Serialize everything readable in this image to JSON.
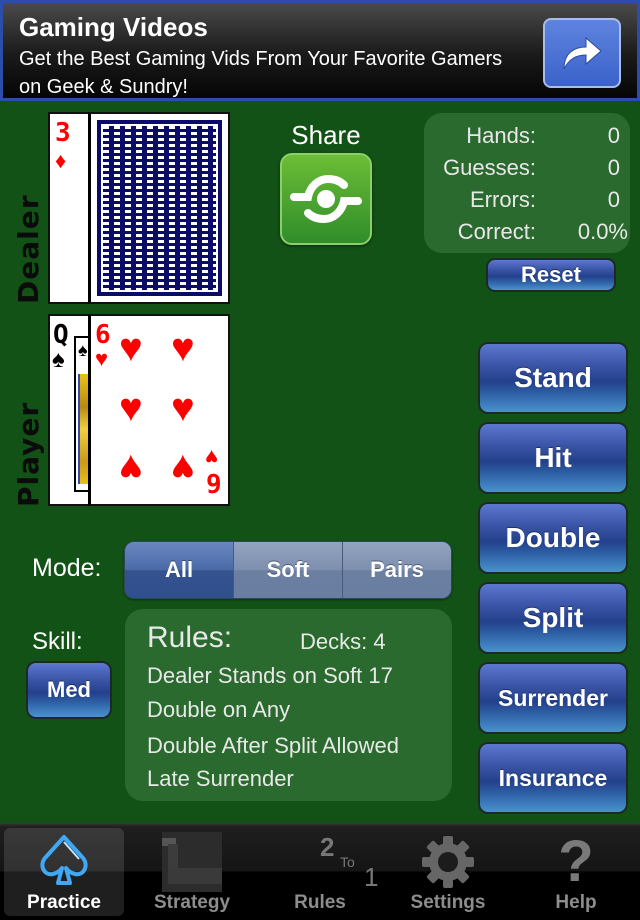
{
  "ad": {
    "title": "Gaming Videos",
    "text": "Get the Best Gaming Vids From Your Favorite Gamers on Geek & Sundry!",
    "action_icon": "share-arrow-icon"
  },
  "table": {
    "dealer_label": "Dealer",
    "player_label": "Player",
    "dealer_cards": [
      {
        "rank": "3",
        "suit": "diamonds",
        "suit_glyph": "♦"
      },
      {
        "rank": "",
        "suit": "",
        "face_down": true
      }
    ],
    "player_cards": [
      {
        "rank": "Q",
        "suit": "spades",
        "suit_glyph": "♠"
      },
      {
        "rank": "6",
        "suit": "hearts",
        "suit_glyph": "♥",
        "rank_rotated": "9"
      }
    ]
  },
  "share": {
    "label": "Share",
    "icon": "share-icon"
  },
  "stats": {
    "rows": [
      {
        "label": "Hands:",
        "value": "0"
      },
      {
        "label": "Guesses:",
        "value": "0"
      },
      {
        "label": "Errors:",
        "value": "0"
      },
      {
        "label": "Correct:",
        "value": "0.0%"
      }
    ],
    "reset_label": "Reset"
  },
  "actions": [
    {
      "label": "Stand"
    },
    {
      "label": "Hit"
    },
    {
      "label": "Double"
    },
    {
      "label": "Split"
    },
    {
      "label": "Surrender"
    },
    {
      "label": "Insurance"
    }
  ],
  "mode": {
    "label": "Mode:",
    "options": [
      "All",
      "Soft",
      "Pairs"
    ],
    "selected": "All"
  },
  "skill": {
    "label": "Skill:",
    "value": "Med"
  },
  "rules": {
    "title": "Rules:",
    "decks": "Decks: 4",
    "lines": [
      "Dealer Stands on Soft 17",
      "Double on Any",
      "Double After Split Allowed",
      "Late Surrender"
    ]
  },
  "tabbar": {
    "tabs": [
      {
        "label": "Practice",
        "icon": "spade-icon",
        "active": true
      },
      {
        "label": "Strategy",
        "icon": "strategy-chart-icon",
        "active": false
      },
      {
        "label": "Rules",
        "icon": "two-to-one-icon",
        "active": false,
        "icon_text_top": "2",
        "icon_text_mid": "To",
        "icon_text_bottom": "1"
      },
      {
        "label": "Settings",
        "icon": "gear-icon",
        "active": false
      },
      {
        "label": "Help",
        "icon": "question-icon",
        "active": false
      }
    ]
  },
  "colors": {
    "felt": "#125217",
    "panel": "#2a6a2e",
    "button_blue": "#23408c",
    "share_green": "#4fa42f",
    "card_red": "#ff0000",
    "card_back_blue": "#0b0c6a"
  }
}
